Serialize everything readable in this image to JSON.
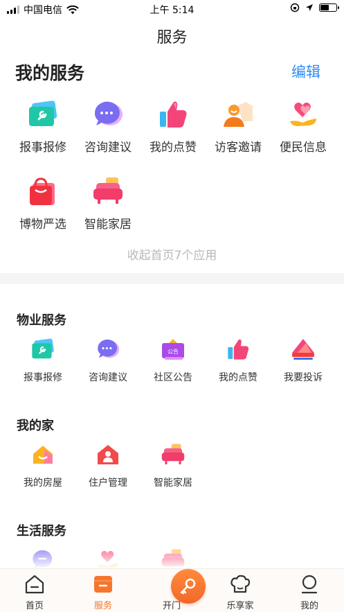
{
  "status_bar": {
    "carrier": "中国电信",
    "time": "上午 5:14",
    "battery_level": 0.55
  },
  "nav": {
    "title": "服务"
  },
  "my_services": {
    "heading": "我的服务",
    "edit_label": "编辑",
    "items": [
      {
        "label": "报事报修",
        "icon": "wrench-card-icon"
      },
      {
        "label": "咨询建议",
        "icon": "chat-bubble-icon"
      },
      {
        "label": "我的点赞",
        "icon": "thumbs-up-icon"
      },
      {
        "label": "访客邀请",
        "icon": "visitor-icon"
      },
      {
        "label": "便民信息",
        "icon": "heart-hand-icon"
      },
      {
        "label": "博物严选",
        "icon": "shopping-bag-icon"
      },
      {
        "label": "智能家居",
        "icon": "sofa-icon"
      }
    ],
    "collapse_label": "收起首页7个应用"
  },
  "categories": [
    {
      "title": "物业服务",
      "items": [
        {
          "label": "报事报修",
          "icon": "wrench-card-icon"
        },
        {
          "label": "咨询建议",
          "icon": "chat-bubble-icon"
        },
        {
          "label": "社区公告",
          "icon": "notice-board-icon",
          "badge": "公告"
        },
        {
          "label": "我的点赞",
          "icon": "thumbs-up-icon"
        },
        {
          "label": "我要投诉",
          "icon": "complaint-icon"
        }
      ]
    },
    {
      "title": "我的家",
      "items": [
        {
          "label": "我的房屋",
          "icon": "house-icon"
        },
        {
          "label": "住户管理",
          "icon": "resident-house-icon"
        },
        {
          "label": "智能家居",
          "icon": "sofa-icon"
        }
      ]
    },
    {
      "title": "生活服务",
      "items": [
        {
          "label": "",
          "icon": "chat-bubble-icon"
        },
        {
          "label": "",
          "icon": "heart-hand-icon"
        },
        {
          "label": "",
          "icon": "sofa-icon"
        }
      ]
    }
  ],
  "tab_bar": {
    "tabs": [
      {
        "label": "首页",
        "icon": "home-icon"
      },
      {
        "label": "服务",
        "icon": "service-icon",
        "active": true
      },
      {
        "label": "开门",
        "icon": "key-icon"
      },
      {
        "label": "乐享家",
        "icon": "chef-hat-icon"
      },
      {
        "label": "我的",
        "icon": "profile-icon"
      }
    ]
  },
  "colors": {
    "accent_blue": "#2f8bf6",
    "accent_orange": "#f5752c",
    "muted_text": "#b8b8b8"
  }
}
